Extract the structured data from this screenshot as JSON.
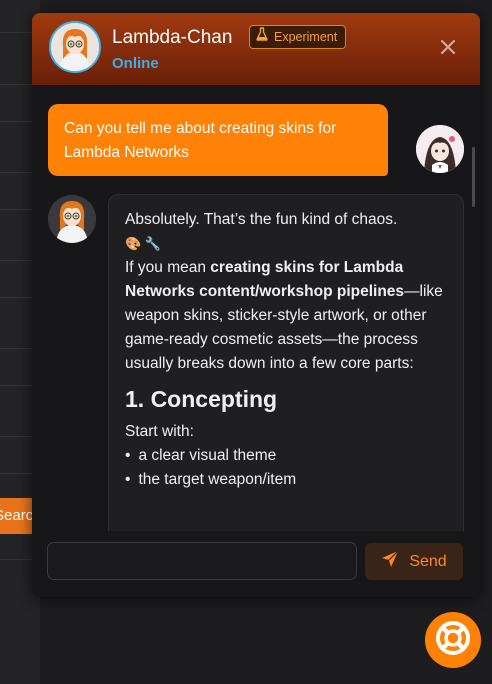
{
  "background": {
    "search_button_label": "Search"
  },
  "chat": {
    "title": "Lambda-Chan",
    "status": "Online",
    "badge_label": "Experiment",
    "badge_icon": "flask-icon",
    "close_icon": "close-icon",
    "messages": [
      {
        "role": "user",
        "text": "Can you tell me about creating skins for Lambda Networks"
      },
      {
        "role": "assistant",
        "intro": "Absolutely. That’s the fun kind of chaos.",
        "emoji": "🎨 🔧",
        "lead": "If you mean ",
        "bold": "creating skins for Lambda Networks content/workshop pipelines",
        "rest": "—like weapon skins, sticker-style artwork, or other game-ready cosmetic assets—the process usually breaks down into a few core parts:",
        "heading": "1. Concepting",
        "subheading": "Start with:",
        "bullets": [
          "a clear visual theme",
          "the target weapon/item"
        ]
      }
    ],
    "composer": {
      "placeholder": "",
      "send_label": "Send",
      "send_icon": "send-icon"
    }
  },
  "launcher": {
    "icon": "lifebuoy-icon"
  },
  "colors": {
    "accent": "#ff8206",
    "status": "#3ab0e8",
    "header_top": "#a13a0f",
    "header_bottom": "#6a1f08"
  }
}
